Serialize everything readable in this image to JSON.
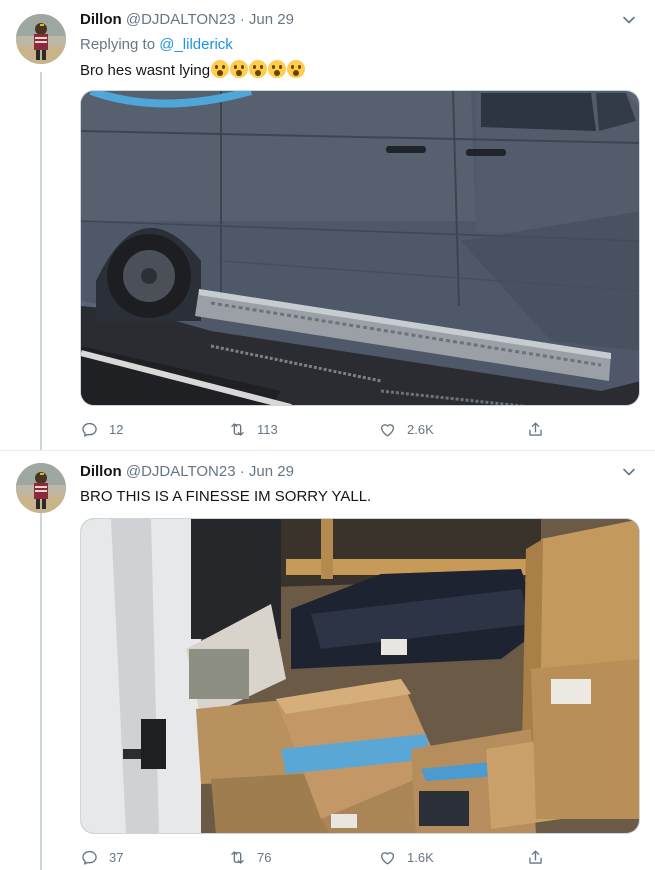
{
  "tweets": [
    {
      "author_name": "Dillon",
      "handle": "@DJDALTON23",
      "separator": "·",
      "date": "Jun 29",
      "replying_to_prefix": "Replying to ",
      "replying_to_mention": "@_lilderick",
      "text": "Bro hes wasnt lying",
      "emoji_count": 5,
      "media_description_icon": "van-photo",
      "stats": {
        "replies": "12",
        "retweets": "113",
        "likes": "2.6K"
      }
    },
    {
      "author_name": "Dillon",
      "handle": "@DJDALTON23",
      "separator": "·",
      "date": "Jun 29",
      "text": "BRO THIS IS A FINESSE IM SORRY YALL.",
      "media_description_icon": "packages-photo",
      "stats": {
        "replies": "37",
        "retweets": "76",
        "likes": "1.6K"
      }
    }
  ],
  "colors": {
    "text_primary": "#14171a",
    "text_secondary": "#657786",
    "link": "#1b95e0",
    "thread_line": "#ccd6dd"
  }
}
